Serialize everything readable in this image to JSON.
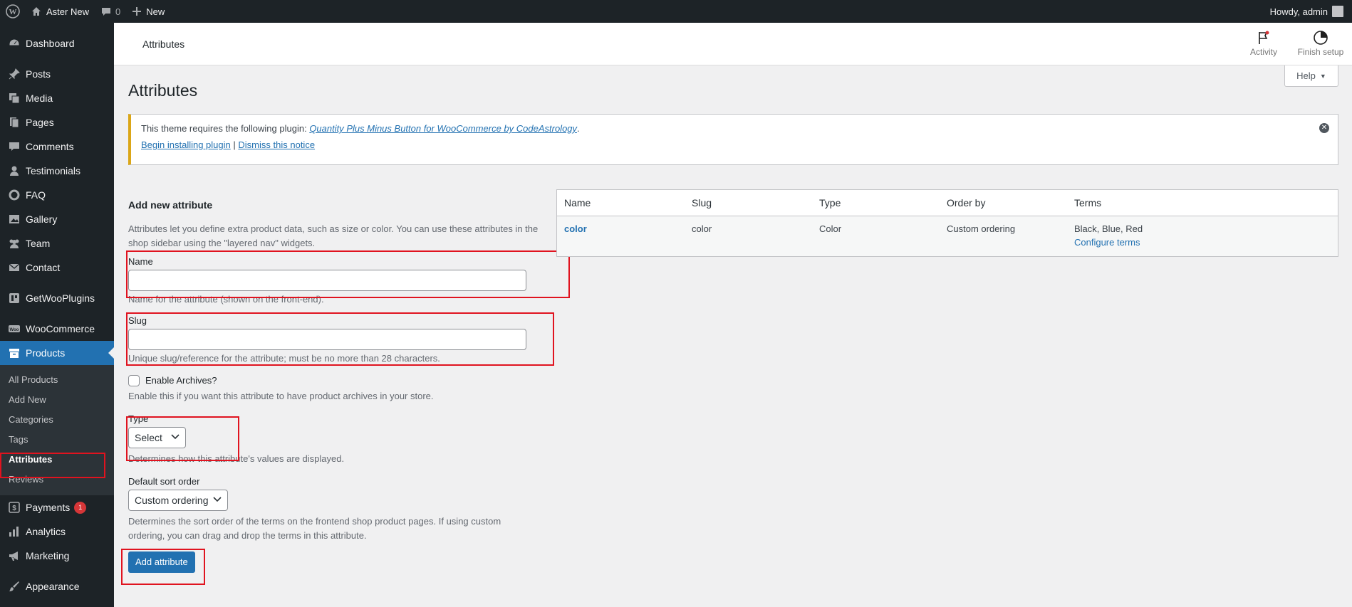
{
  "adminbar": {
    "site_name": "Aster New",
    "comments_count": "0",
    "new_label": "New",
    "howdy": "Howdy, admin"
  },
  "sidebar": {
    "items": [
      {
        "label": "Dashboard",
        "icon": "dashboard-icon"
      },
      {
        "label": "Posts",
        "icon": "pin-icon"
      },
      {
        "label": "Media",
        "icon": "media-icon"
      },
      {
        "label": "Pages",
        "icon": "pages-icon"
      },
      {
        "label": "Comments",
        "icon": "comment-icon"
      },
      {
        "label": "Testimonials",
        "icon": "user-icon"
      },
      {
        "label": "FAQ",
        "icon": "circle-icon"
      },
      {
        "label": "Gallery",
        "icon": "gallery-icon"
      },
      {
        "label": "Team",
        "icon": "team-icon"
      },
      {
        "label": "Contact",
        "icon": "mail-icon"
      },
      {
        "label": "GetWooPlugins",
        "icon": "plugin-icon"
      },
      {
        "label": "WooCommerce",
        "icon": "woo-icon"
      },
      {
        "label": "Products",
        "icon": "archive-icon"
      },
      {
        "label": "Payments",
        "icon": "dollar-icon",
        "badge": "1"
      },
      {
        "label": "Analytics",
        "icon": "chart-icon"
      },
      {
        "label": "Marketing",
        "icon": "megaphone-icon"
      },
      {
        "label": "Appearance",
        "icon": "brush-icon"
      }
    ],
    "products_submenu": [
      "All Products",
      "Add New",
      "Categories",
      "Tags",
      "Attributes",
      "Reviews"
    ]
  },
  "header": {
    "title": "Attributes",
    "activity_label": "Activity",
    "finish_setup_label": "Finish setup"
  },
  "help_label": "Help",
  "page_title": "Attributes",
  "notice": {
    "text_before": "This theme requires the following plugin:",
    "plugin_link": "Quantity Plus Minus Button for WooCommerce by CodeAstrology",
    "text_after": ".",
    "install_link": "Begin installing plugin",
    "separator": "|",
    "dismiss_link": "Dismiss this notice"
  },
  "form": {
    "title": "Add new attribute",
    "intro": "Attributes let you define extra product data, such as size or color. You can use these attributes in the shop sidebar using the \"layered nav\" widgets.",
    "name_label": "Name",
    "name_value": "",
    "name_desc": "Name for the attribute (shown on the front-end).",
    "slug_label": "Slug",
    "slug_value": "",
    "slug_desc": "Unique slug/reference for the attribute; must be no more than 28 characters.",
    "archives_label": "Enable Archives?",
    "archives_desc": "Enable this if you want this attribute to have product archives in your store.",
    "type_label": "Type",
    "type_value": "Select",
    "type_desc": "Determines how this attribute's values are displayed.",
    "sort_label": "Default sort order",
    "sort_value": "Custom ordering",
    "sort_desc": "Determines the sort order of the terms on the frontend shop product pages. If using custom ordering, you can drag and drop the terms in this attribute.",
    "submit_label": "Add attribute"
  },
  "table": {
    "headers": [
      "Name",
      "Slug",
      "Type",
      "Order by",
      "Terms"
    ],
    "rows": [
      {
        "name": "color",
        "slug": "color",
        "type": "Color",
        "order_by": "Custom ordering",
        "terms": "Black, Blue, Red",
        "configure": "Configure terms"
      }
    ]
  },
  "colors": {
    "admin_dark": "#1d2327",
    "accent": "#2271b1",
    "highlight_box": "#e0131f",
    "notice_warning": "#dba617"
  }
}
